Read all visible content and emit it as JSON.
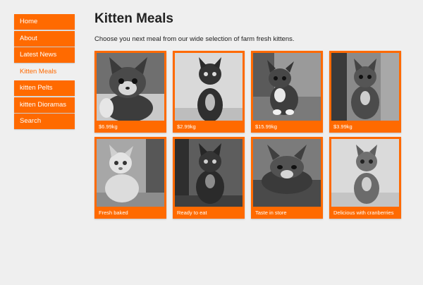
{
  "nav": {
    "items": [
      {
        "label": "Home"
      },
      {
        "label": "About"
      },
      {
        "label": "Latest News"
      },
      {
        "label": "Kitten Meals",
        "active": true
      },
      {
        "label": "kitten Pelts"
      },
      {
        "label": "kitten Dioramas"
      },
      {
        "label": "Search"
      }
    ]
  },
  "page": {
    "title": "Kitten Meals",
    "intro": "Choose you next meal from our wide selection of farm fresh kittens."
  },
  "colors": {
    "accent": "#ff6a00",
    "background": "#efefef"
  },
  "products": [
    {
      "caption": "$6.99kg",
      "image": "grey-tabby-kitten-photo"
    },
    {
      "caption": "$2.99kg",
      "image": "sitting-dark-kitten-photo"
    },
    {
      "caption": "$15.99kg",
      "image": "tabby-kitten-on-steps-photo"
    },
    {
      "caption": "$3.99kg",
      "image": "tabby-kitten-by-door-photo"
    },
    {
      "caption": "Fresh baked",
      "image": "ginger-white-kitten-photo"
    },
    {
      "caption": "Ready to eat",
      "image": "dark-kitten-in-room-photo"
    },
    {
      "caption": "Taste in store",
      "image": "tabby-kitten-crouching-photo"
    },
    {
      "caption": "Delicious with cranberries",
      "image": "grey-kitten-sitting-photo"
    }
  ]
}
